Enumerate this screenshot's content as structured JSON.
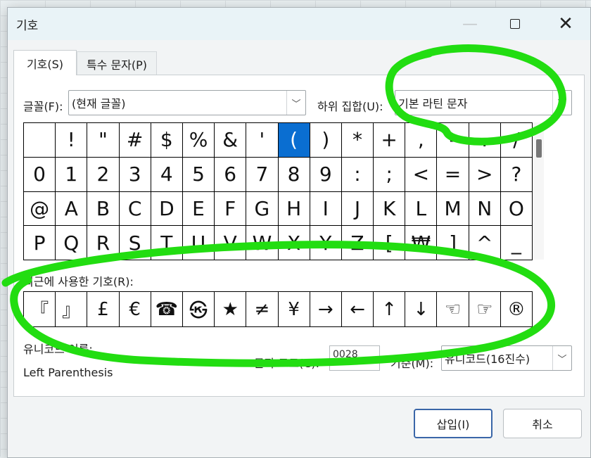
{
  "dialog": {
    "title": "기호",
    "tabs": [
      "기호(S)",
      "특수 문자(P)"
    ]
  },
  "font": {
    "label": "글꼴(F):",
    "value": "(현재 글꼴)"
  },
  "subset": {
    "label": "하위 집합(U):",
    "value": "기본 라틴 문자"
  },
  "symbols": {
    "rows": [
      [
        " ",
        "!",
        "\"",
        "#",
        "$",
        "%",
        "&",
        "'",
        "(",
        ")",
        "*",
        "+",
        ",",
        "-",
        ".",
        "/"
      ],
      [
        "0",
        "1",
        "2",
        "3",
        "4",
        "5",
        "6",
        "7",
        "8",
        "9",
        ":",
        ";",
        "<",
        "=",
        ">",
        "?"
      ],
      [
        "@",
        "A",
        "B",
        "C",
        "D",
        "E",
        "F",
        "G",
        "H",
        "I",
        "J",
        "K",
        "L",
        "M",
        "N",
        "O"
      ],
      [
        "P",
        "Q",
        "R",
        "S",
        "T",
        "U",
        "V",
        "W",
        "X",
        "Y",
        "Z",
        "[",
        "₩",
        "]",
        "^",
        "_"
      ]
    ],
    "selected": "("
  },
  "recent": {
    "label": "최근에 사용한 기호(R):",
    "items": [
      "『",
      "』",
      "£",
      "€",
      "☎",
      "㉿",
      "★",
      "≠",
      "¥",
      "→",
      "←",
      "↑",
      "↓",
      "☜",
      "☞",
      "®"
    ]
  },
  "unicode": {
    "name_label": "유니코드 이름:",
    "name_value": "Left Parenthesis",
    "code_label": "문자 코드(C):",
    "code_value": "0028",
    "basis_label": "기준(M):",
    "basis_value": "유니코드(16진수)"
  },
  "buttons": {
    "insert": "삽입(I)",
    "cancel": "취소"
  },
  "annotation_color": "#22dd11"
}
